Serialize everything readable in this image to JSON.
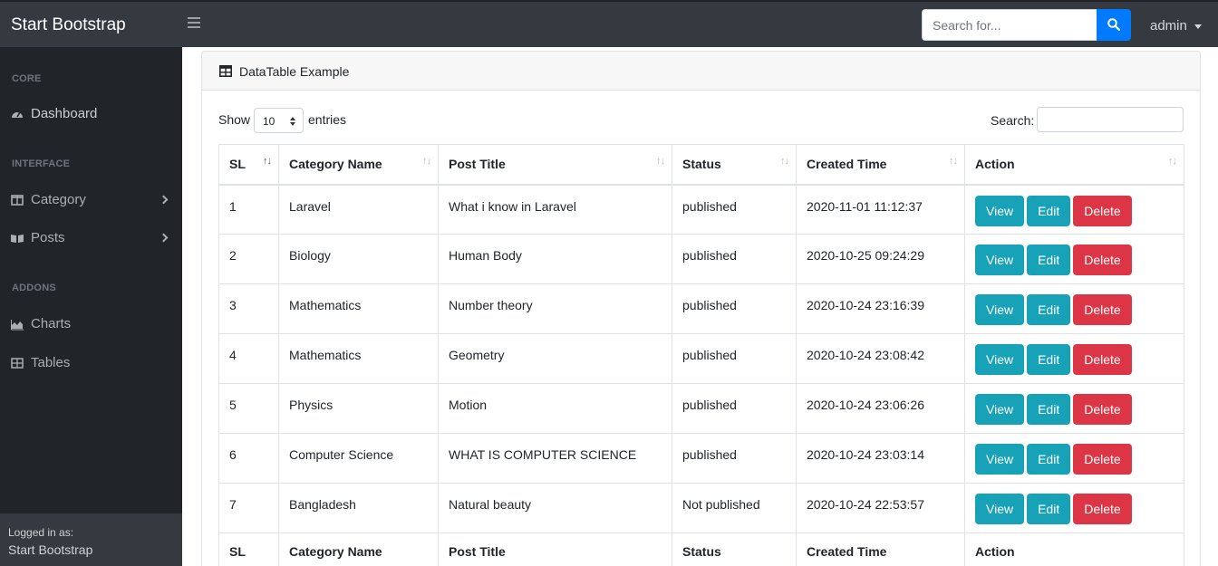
{
  "navbar": {
    "brand": "Start Bootstrap",
    "search_placeholder": "Search for...",
    "user": "admin"
  },
  "sidebar": {
    "sections": [
      {
        "heading": "CORE"
      },
      {
        "heading": "INTERFACE"
      },
      {
        "heading": "ADDONS"
      }
    ],
    "items": [
      {
        "label": "Dashboard",
        "icon": "tachometer-icon"
      },
      {
        "label": "Category",
        "icon": "columns-icon"
      },
      {
        "label": "Posts",
        "icon": "book-open-icon"
      },
      {
        "label": "Charts",
        "icon": "area-chart-icon"
      },
      {
        "label": "Tables",
        "icon": "table-icon"
      }
    ],
    "footer": {
      "small": "Logged in as:",
      "name": "Start Bootstrap"
    }
  },
  "card": {
    "title": "DataTable Example",
    "show_label": "Show",
    "length_value": "10",
    "entries_label": "entries",
    "search_label": "Search:"
  },
  "table": {
    "columns": [
      "SL",
      "Category Name",
      "Post Title",
      "Status",
      "Created Time",
      "Action"
    ],
    "rows": [
      {
        "sl": "1",
        "category": "Laravel",
        "title": "What i know in Laravel",
        "status": "published",
        "created": "2020-11-01 11:12:37"
      },
      {
        "sl": "2",
        "category": "Biology",
        "title": "Human Body",
        "status": "published",
        "created": "2020-10-25 09:24:29"
      },
      {
        "sl": "3",
        "category": "Mathematics",
        "title": "Number theory",
        "status": "published",
        "created": "2020-10-24 23:16:39"
      },
      {
        "sl": "4",
        "category": "Mathematics",
        "title": "Geometry",
        "status": "published",
        "created": "2020-10-24 23:08:42"
      },
      {
        "sl": "5",
        "category": "Physics",
        "title": "Motion",
        "status": "published",
        "created": "2020-10-24 23:06:26"
      },
      {
        "sl": "6",
        "category": "Computer Science",
        "title": "WHAT IS COMPUTER SCIENCE",
        "status": "published",
        "created": "2020-10-24 23:03:14"
      },
      {
        "sl": "7",
        "category": "Bangladesh",
        "title": "Natural beauty",
        "status": "Not published",
        "created": "2020-10-24 22:53:57"
      }
    ],
    "actions": {
      "view": "View",
      "edit": "Edit",
      "delete": "Delete"
    }
  },
  "colors": {
    "navbar": "#343a40",
    "sidebar": "#212529",
    "primary": "#007bff",
    "info": "#17a2b8",
    "danger": "#dc3545"
  }
}
